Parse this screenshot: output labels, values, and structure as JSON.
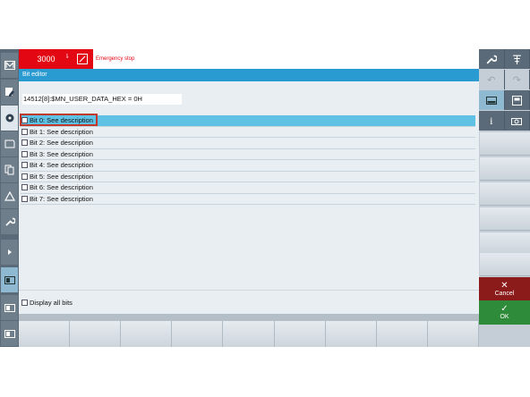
{
  "header": {
    "alarm_number": "3000",
    "alarm_text": "Emergency stop"
  },
  "window": {
    "title": "Bit editor"
  },
  "editor": {
    "parameter": "14512[8]:$MN_USER_DATA_HEX = 0H",
    "bits": [
      {
        "label": "Bit 0: See description",
        "checked": false,
        "selected": true
      },
      {
        "label": "Bit 1: See description",
        "checked": false,
        "selected": false
      },
      {
        "label": "Bit 2: See description",
        "checked": false,
        "selected": false
      },
      {
        "label": "Bit 3: See description",
        "checked": false,
        "selected": false
      },
      {
        "label": "Bit 4: See description",
        "checked": false,
        "selected": false
      },
      {
        "label": "Bit 5: See description",
        "checked": false,
        "selected": false
      },
      {
        "label": "Bit 6: See description",
        "checked": false,
        "selected": false
      },
      {
        "label": "Bit 7: See description",
        "checked": false,
        "selected": false
      }
    ],
    "display_all_bits_label": "Display all bits"
  },
  "softkeys": {
    "cancel_label": "Cancel",
    "ok_label": "OK"
  },
  "colors": {
    "alarm": "#e30613",
    "titlebar": "#2a9bd0",
    "selected_row": "#5fc1e4",
    "cancel": "#8b1a1a",
    "ok": "#2e8b3a"
  },
  "icons": {
    "machine": "machine-icon",
    "parameter": "parameter-icon",
    "program": "program-icon",
    "program_manager": "program-manager-icon",
    "diagnostics": "diagnostics-warning-icon",
    "commissioning": "wrench-icon",
    "expand": "chevron-right-icon",
    "undo": "undo-icon",
    "redo": "redo-icon",
    "info": "info-icon",
    "camera": "screenshot-icon"
  }
}
